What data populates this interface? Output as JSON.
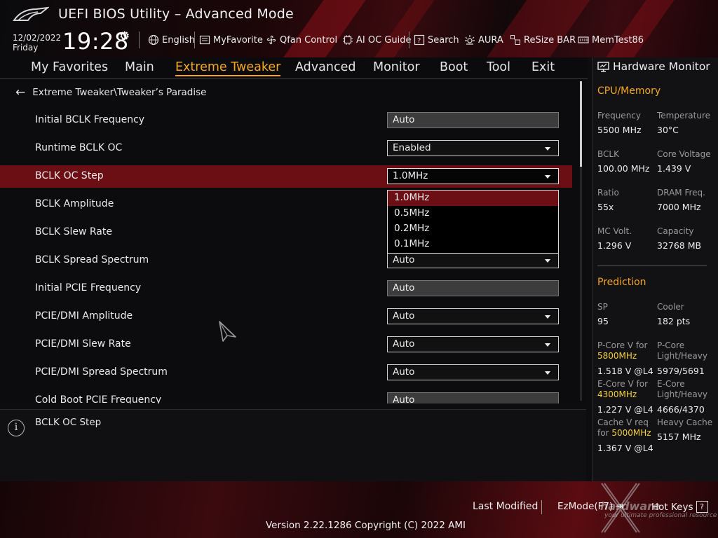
{
  "header": {
    "title": "UEFI BIOS Utility – Advanced Mode",
    "date": "12/02/2022",
    "day": "Friday",
    "time": "19:28",
    "tools": [
      {
        "label": "English",
        "icon": "globe-icon"
      },
      {
        "label": "MyFavorite",
        "icon": "favorite-icon"
      },
      {
        "label": "Qfan Control",
        "icon": "fan-icon"
      },
      {
        "label": "AI OC Guide",
        "icon": "chip-icon"
      },
      {
        "label": "Search",
        "icon": "search-icon"
      },
      {
        "label": "AURA",
        "icon": "aura-icon"
      },
      {
        "label": "ReSize BAR",
        "icon": "resize-bar-icon"
      },
      {
        "label": "MemTest86",
        "icon": "memtest-icon"
      }
    ]
  },
  "tabs": [
    "My Favorites",
    "Main",
    "Extreme Tweaker",
    "Advanced",
    "Monitor",
    "Boot",
    "Tool",
    "Exit"
  ],
  "active_tab": "Extreme Tweaker",
  "breadcrumb": "Extreme Tweaker\\Tweaker’s Paradise",
  "settings": [
    {
      "label": "Initial BCLK Frequency",
      "value": "Auto",
      "kind": "readonly"
    },
    {
      "label": "Runtime BCLK OC",
      "value": "Enabled",
      "kind": "dropdown"
    },
    {
      "label": "BCLK OC Step",
      "value": "1.0MHz",
      "kind": "dropdown",
      "selected": true
    },
    {
      "label": "BCLK Amplitude",
      "value": "",
      "kind": "hidden"
    },
    {
      "label": "BCLK Slew Rate",
      "value": "",
      "kind": "hidden"
    },
    {
      "label": "BCLK Spread Spectrum",
      "value": "Auto",
      "kind": "dropdown"
    },
    {
      "label": "Initial PCIE Frequency",
      "value": "Auto",
      "kind": "readonly"
    },
    {
      "label": "PCIE/DMI Amplitude",
      "value": "Auto",
      "kind": "dropdown"
    },
    {
      "label": "PCIE/DMI Slew Rate",
      "value": "Auto",
      "kind": "dropdown"
    },
    {
      "label": "PCIE/DMI Spread Spectrum",
      "value": "Auto",
      "kind": "dropdown"
    },
    {
      "label": "Cold Boot PCIE Frequency",
      "value": "Auto",
      "kind": "readonly"
    }
  ],
  "dropdown_options": [
    "1.0MHz",
    "0.5MHz",
    "0.2MHz",
    "0.1MHz"
  ],
  "dropdown_highlighted": "1.0MHz",
  "help_text": "BCLK OC Step",
  "hardware_monitor": {
    "title": "Hardware Monitor",
    "cpu_section": "CPU/Memory",
    "cpu_items": [
      {
        "label": "Frequency",
        "value": "5500 MHz"
      },
      {
        "label": "Temperature",
        "value": "30°C"
      },
      {
        "label": "BCLK",
        "value": "100.00 MHz"
      },
      {
        "label": "Core Voltage",
        "value": "1.439 V"
      },
      {
        "label": "Ratio",
        "value": "55x"
      },
      {
        "label": "DRAM Freq.",
        "value": "7000 MHz"
      },
      {
        "label": "MC Volt.",
        "value": "1.296 V"
      },
      {
        "label": "Capacity",
        "value": "32768 MB"
      }
    ],
    "prediction_section": "Prediction",
    "sp_label": "SP",
    "sp_value": "95",
    "cooler_label": "Cooler",
    "cooler_value": "182 pts",
    "pcore_label": "P-Core V for",
    "pcore_freq": "5800MHz",
    "pcore_value": "1.518 V @L4",
    "pcore_lh_label_1": "P-Core",
    "pcore_lh_label_2": "Light/Heavy",
    "pcore_lh_value": "5979/5691",
    "ecore_label": "E-Core V for",
    "ecore_freq": "4300MHz",
    "ecore_value": "1.227 V @L4",
    "ecore_lh_label_1": "E-Core",
    "ecore_lh_label_2": "Light/Heavy",
    "ecore_lh_value": "4666/4370",
    "cache_label_1": "Cache V req",
    "cache_label_2": "for",
    "cache_freq": "5000MHz",
    "cache_value": "1.367 V @L4",
    "heavy_cache_label": "Heavy Cache",
    "heavy_cache_value": "5157 MHz"
  },
  "footer": {
    "last_modified": "Last Modified",
    "ez_mode": "EzMode(F7)",
    "hot_keys": "Hot Keys",
    "hot_keys_key": "?",
    "version": "Version 2.22.1286 Copyright (C) 2022 AMI"
  },
  "watermark": {
    "text": "hardware",
    "subtext": "your ultimate professional resource"
  },
  "colors": {
    "accent": "#f6a623",
    "selected_row": "#6b0f14",
    "highlight_yellow": "#f4d03f"
  }
}
